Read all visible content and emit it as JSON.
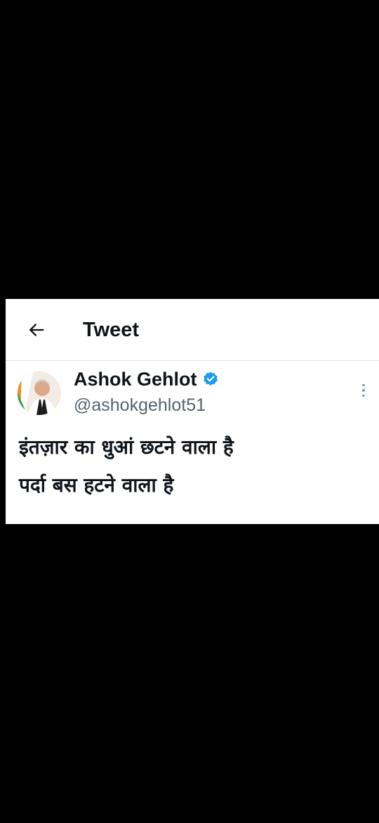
{
  "header": {
    "back_icon": "arrow-left-icon",
    "title": "Tweet"
  },
  "author": {
    "display_name": "Ashok Gehlot",
    "handle": "@ashokgehlot51",
    "verified_icon": "verified-badge-icon",
    "verified_color": "#1d9bf0"
  },
  "tweet": {
    "lines": [
      "इंतज़ार का धुआं छटने वाला है",
      "पर्दा बस हटने वाला है"
    ]
  },
  "menu": {
    "icon": "more-vertical-icon"
  }
}
